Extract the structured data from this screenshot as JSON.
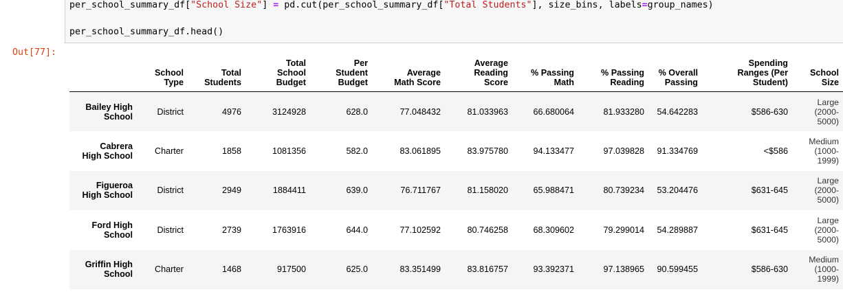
{
  "input_cell": {
    "line1": {
      "p1": "per_school_summary_df[",
      "s1": "\"School Size\"",
      "p2": "] ",
      "op": "=",
      "p3": " pd.cut(per_school_summary_df[",
      "s2": "\"Total Students\"",
      "p4": "], size_bins, labels",
      "op2": "=",
      "p5": "group_names)"
    },
    "line2": "per_school_summary_df.head()"
  },
  "output_prompt": "Out[77]:",
  "table": {
    "columns": [
      "School Type",
      "Total Students",
      "Total School Budget",
      "Per Student Budget",
      "Average Math Score",
      "Average Reading Score",
      "% Passing Math",
      "% Passing Reading",
      "% Overall Passing",
      "Spending Ranges (Per Student)",
      "School Size"
    ],
    "header_lines": [
      [
        "School",
        "Type"
      ],
      [
        "Total",
        "Students"
      ],
      [
        "Total",
        "School",
        "Budget"
      ],
      [
        "Per",
        "Student",
        "Budget"
      ],
      [
        "Average",
        "Math Score"
      ],
      [
        "Average",
        "Reading",
        "Score"
      ],
      [
        "% Passing",
        "Math"
      ],
      [
        "% Passing",
        "Reading"
      ],
      [
        "% Overall",
        "Passing"
      ],
      [
        "Spending",
        "Ranges (Per",
        "Student)"
      ],
      [
        "School",
        "Size"
      ]
    ],
    "rows": [
      {
        "index_lines": [
          "Bailey High",
          "School"
        ],
        "cells": [
          "District",
          "4976",
          "3124928",
          "628.0",
          "77.048432",
          "81.033963",
          "66.680064",
          "81.933280",
          "54.642283",
          "$586-630"
        ],
        "size_lines": [
          "Large",
          "(2000-",
          "5000)"
        ]
      },
      {
        "index_lines": [
          "Cabrera",
          "High School"
        ],
        "cells": [
          "Charter",
          "1858",
          "1081356",
          "582.0",
          "83.061895",
          "83.975780",
          "94.133477",
          "97.039828",
          "91.334769",
          "<$586"
        ],
        "size_lines": [
          "Medium",
          "(1000-",
          "1999)"
        ]
      },
      {
        "index_lines": [
          "Figueroa",
          "High School"
        ],
        "cells": [
          "District",
          "2949",
          "1884411",
          "639.0",
          "76.711767",
          "81.158020",
          "65.988471",
          "80.739234",
          "53.204476",
          "$631-645"
        ],
        "size_lines": [
          "Large",
          "(2000-",
          "5000)"
        ]
      },
      {
        "index_lines": [
          "Ford High",
          "School"
        ],
        "cells": [
          "District",
          "2739",
          "1763916",
          "644.0",
          "77.102592",
          "80.746258",
          "68.309602",
          "79.299014",
          "54.289887",
          "$631-645"
        ],
        "size_lines": [
          "Large",
          "(2000-",
          "5000)"
        ]
      },
      {
        "index_lines": [
          "Griffin High",
          "School"
        ],
        "cells": [
          "Charter",
          "1468",
          "917500",
          "625.0",
          "83.351499",
          "83.816757",
          "93.392371",
          "97.138965",
          "90.599455",
          "$586-630"
        ],
        "size_lines": [
          "Medium",
          "(1000-",
          "1999)"
        ]
      }
    ]
  },
  "colors": {
    "prompt_out": "#d84315",
    "code_string": "#ba2121",
    "code_operator": "#aa22ff",
    "cell_background": "#f7f7f7",
    "row_stripe": "#f5f5f5"
  }
}
